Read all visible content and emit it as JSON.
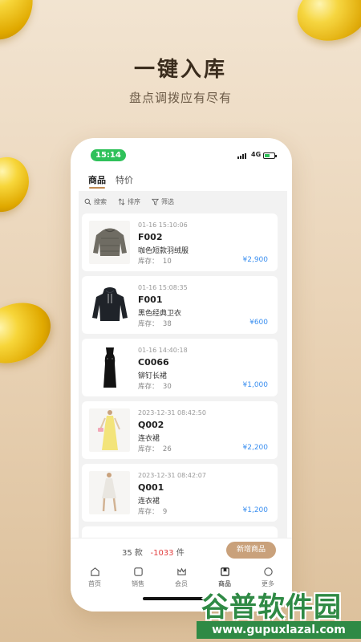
{
  "headline": "一键入库",
  "subline": "盘点调拨应有尽有",
  "status": {
    "time": "15:14",
    "network": "4G"
  },
  "tabs": [
    {
      "label": "商品",
      "active": true
    },
    {
      "label": "特价",
      "active": false
    }
  ],
  "toolbar": {
    "search": "搜索",
    "sort": "排序",
    "filter": "筛选"
  },
  "products": [
    {
      "date": "01-16 15:10:06",
      "code": "F002",
      "name": "咖色短款羽绒服",
      "stock_label": "库存：",
      "stock": "10",
      "price": "¥2,900"
    },
    {
      "date": "01-16 15:08:35",
      "code": "F001",
      "name": "黑色经典卫衣",
      "stock_label": "库存：",
      "stock": "38",
      "price": "¥600"
    },
    {
      "date": "01-16 14:40:18",
      "code": "C0066",
      "name": "铆钉长裙",
      "stock_label": "库存：",
      "stock": "30",
      "price": "¥1,000"
    },
    {
      "date": "2023-12-31 08:42:50",
      "code": "Q002",
      "name": "连衣裙",
      "stock_label": "库存：",
      "stock": "26",
      "price": "¥2,200"
    },
    {
      "date": "2023-12-31 08:42:07",
      "code": "Q001",
      "name": "连衣裙",
      "stock_label": "库存：",
      "stock": "9",
      "price": "¥1,200"
    }
  ],
  "summary": {
    "count": "35",
    "count_unit": "款",
    "qty": "-1033",
    "qty_unit": "件"
  },
  "add_button": "新增商品",
  "nav": [
    {
      "label": "首页",
      "icon": "home-icon"
    },
    {
      "label": "销售",
      "icon": "sales-icon"
    },
    {
      "label": "会员",
      "icon": "member-icon"
    },
    {
      "label": "商品",
      "icon": "product-icon",
      "active": true
    },
    {
      "label": "更多",
      "icon": "more-icon"
    }
  ],
  "watermark": {
    "title": "谷普软件园",
    "url": "www.gupuxlazal.com"
  },
  "colors": {
    "accent": "#c9a17b",
    "price": "#3b8ff0",
    "negative": "#e23d3d",
    "time_pill": "#2fc15a"
  }
}
